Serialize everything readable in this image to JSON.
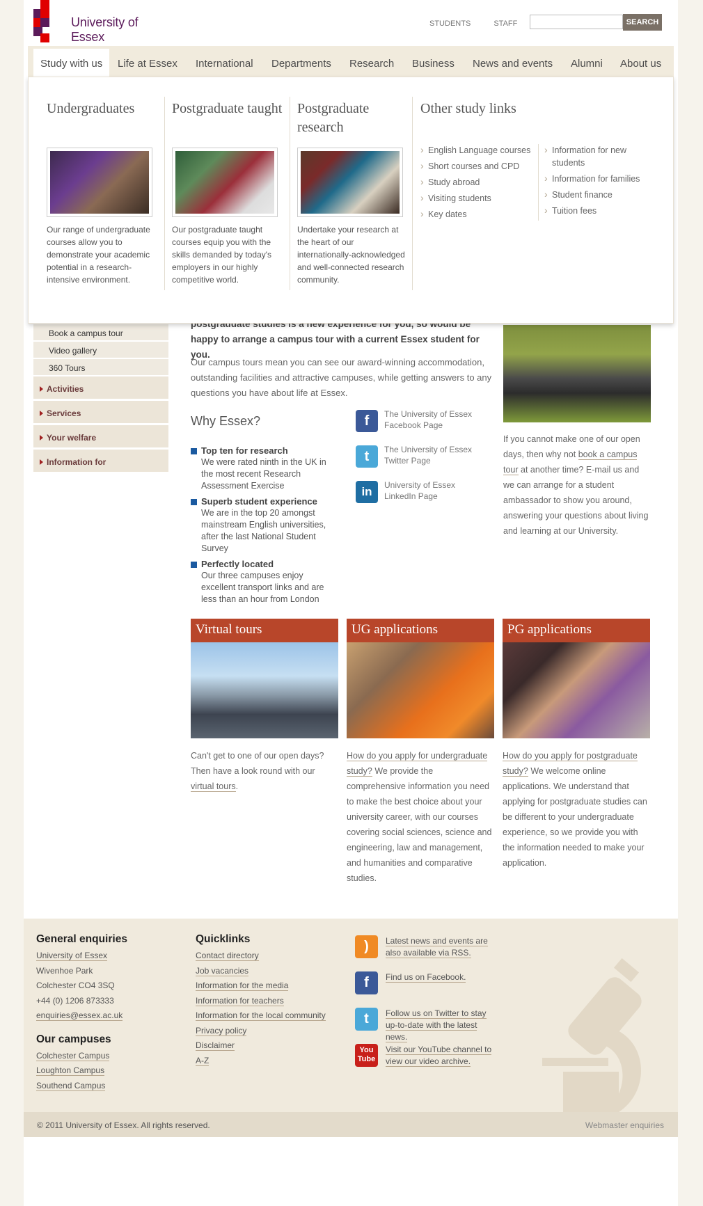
{
  "header": {
    "logo_text": "University of Essex",
    "top_links": [
      "STUDENTS",
      "STAFF"
    ],
    "search_placeholder": "",
    "search_button": "SEARCH"
  },
  "nav": {
    "items": [
      "Study with us",
      "Life at Essex",
      "International",
      "Departments",
      "Research",
      "Business",
      "News and events",
      "Alumni",
      "About us"
    ]
  },
  "mega_menu": {
    "undergraduates": {
      "title": "Undergraduates",
      "text": "Our range of undergraduate courses allow you to demonstrate your academic potential in a research-intensive environment."
    },
    "postgraduate_taught": {
      "title": "Postgraduate taught",
      "text": "Our postgraduate taught courses equip you with the skills demanded by today's employers in our highly competitive world."
    },
    "postgraduate_research": {
      "title": "Postgraduate research",
      "text": "Undertake your research at the heart of our internationally-acknowledged and well-connected research community."
    },
    "other": {
      "title": "Other study links",
      "col1": [
        "English Language courses",
        "Short courses and CPD",
        "Study abroad",
        "Visiting students",
        "Key dates"
      ],
      "col2": [
        "Information for new students",
        "Information for families",
        "Student finance",
        "Tuition fees"
      ]
    }
  },
  "sidebar": {
    "sub_items": [
      "Book a campus tour",
      "Video gallery",
      "360 Tours"
    ],
    "main_items": [
      "Activities",
      "Services",
      "Your welfare",
      "Information for"
    ]
  },
  "content": {
    "intro_partial": "postgraduate studies is a new experience for you, so would be happy to arrange a campus tour with a current Essex student for you.",
    "body": "Our campus tours mean you can see our award-winning accommodation, outstanding facilities and attractive campuses, while getting answers to any questions you have about life at Essex.",
    "why_heading": "Why Essex?",
    "why_items": [
      {
        "title": "Top ten for research",
        "text": "We were rated ninth in the UK in the most recent Research Assessment Exercise"
      },
      {
        "title": "Superb student experience",
        "text": "We are in the top 20 amongst mainstream English universities, after the last National Student Survey"
      },
      {
        "title": "Perfectly located",
        "text": "Our three campuses enjoy excellent transport links and are less than an hour from London"
      }
    ],
    "social": [
      {
        "icon": "facebook-icon",
        "text": "The University of Essex Facebook Page"
      },
      {
        "icon": "twitter-icon",
        "text": "The University of Essex Twitter Page"
      },
      {
        "icon": "linkedin-icon",
        "text": "University of Essex LinkedIn Page"
      }
    ],
    "right_text_pre": "If you cannot make one of our open days, then why not ",
    "right_link": "book a campus tour",
    "right_text_post": " at another time? E-mail us and we can arrange for a student ambassador to show you around, answering your questions about living and learning at our University."
  },
  "panels": [
    {
      "title": "Virtual tours",
      "pre": "Can't get to one of our open days? Then have a look round with our ",
      "link": "virtual tours",
      "post": "."
    },
    {
      "title": "UG applications",
      "pre": "",
      "link": "How do you apply for undergraduate study?",
      "post": " We provide the comprehensive information you need to make the best choice about your university career, with our courses covering social sciences, science and engineering, law and management, and humanities and comparative studies."
    },
    {
      "title": "PG applications",
      "pre": "",
      "link": "How do you apply for postgraduate study?",
      "post": " We welcome online applications. We understand that applying for postgraduate studies can be different to your undergraduate experience, so we provide you with the information needed to make your application."
    }
  ],
  "footer": {
    "general_heading": "General enquiries",
    "general_lines": [
      "University of Essex",
      "Wivenhoe Park",
      "Colchester CO4 3SQ",
      "+44 (0) 1206 873333",
      "enquiries@essex.ac.uk"
    ],
    "campuses_heading": "Our campuses",
    "campuses": [
      "Colchester Campus",
      "Loughton Campus",
      "Southend Campus"
    ],
    "quicklinks_heading": "Quicklinks",
    "quicklinks": [
      "Contact directory",
      "Job vacancies",
      "Information for the media",
      "Information for teachers",
      "Information for the local community",
      "Privacy policy",
      "Disclaimer",
      "A-Z"
    ],
    "social": [
      {
        "icon": "rss-icon",
        "text": "Latest news and events are also available via RSS."
      },
      {
        "icon": "facebook-icon",
        "text": "Find us on Facebook."
      },
      {
        "icon": "twitter-icon",
        "text": "Follow us on Twitter to stay up-to-date with the latest news."
      },
      {
        "icon": "youtube-icon",
        "text": "Visit our YouTube channel to view our video archive."
      }
    ],
    "copyright": "© 2011 University of Essex. All rights reserved.",
    "webmaster": "Webmaster enquiries"
  },
  "colors": {
    "brand_purple": "#5b1a5a",
    "brand_red": "#e00000",
    "panel_orange": "#b8462a",
    "link_blue": "#1b5aa0"
  }
}
